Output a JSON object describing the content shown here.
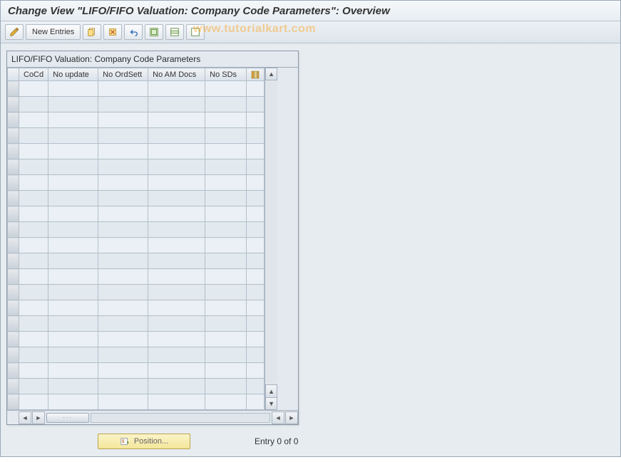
{
  "header": {
    "title": "Change View \"LIFO/FIFO Valuation: Company Code Parameters\": Overview"
  },
  "toolbar": {
    "new_entries_label": "New Entries"
  },
  "watermark": "www.tutorialkart.com",
  "panel": {
    "title": "LIFO/FIFO Valuation: Company Code Parameters",
    "columns": {
      "c0": "CoCd",
      "c1": "No update",
      "c2": "No OrdSett",
      "c3": "No AM Docs",
      "c4": "No SDs"
    }
  },
  "footer": {
    "position_label": "Position...",
    "entry_label": "Entry 0 of 0"
  }
}
